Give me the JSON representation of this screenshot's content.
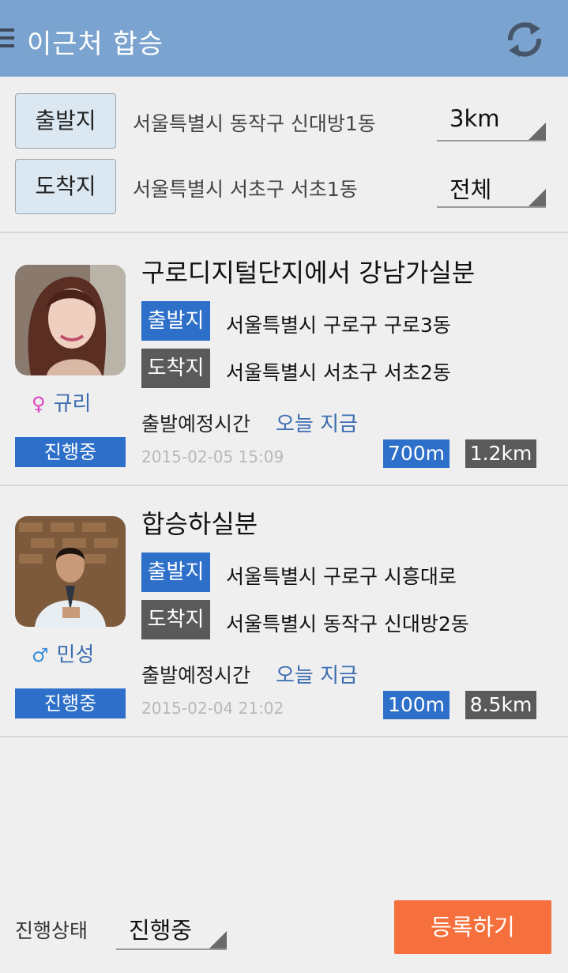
{
  "appbar": {
    "title": "이근처 합승",
    "menu_icon": "menu-icon",
    "refresh_icon": "refresh-icon"
  },
  "filter": {
    "origin": {
      "button_label": "출발지",
      "address": "서울특별시 동작구 신대방1동",
      "radius": "3km"
    },
    "destination": {
      "button_label": "도착지",
      "address": "서울특별시 서초구 서초1동",
      "radius": "전체"
    }
  },
  "cards": [
    {
      "title": "구로디지털단지에서 강남가실분",
      "user_name": "규리",
      "gender_symbol": "♀",
      "status": "진행중",
      "origin_tag": "출발지",
      "origin": "서울특별시 구로구 구로3동",
      "dest_tag": "도착지",
      "destination": "서울특별시 서초구 서초2동",
      "schedule_label": "출발예정시간",
      "schedule_value": "오늘 지금",
      "date": "2015-02-05 15:09",
      "distance_origin": "700m",
      "distance_dest": "1.2km"
    },
    {
      "title": "합승하실분",
      "user_name": "민성",
      "gender_symbol": "♂",
      "status": "진행중",
      "origin_tag": "출발지",
      "origin": "서울특별시 구로구 시흥대로",
      "dest_tag": "도착지",
      "destination": "서울특별시 동작구 신대방2동",
      "schedule_label": "출발예정시간",
      "schedule_value": "오늘 지금",
      "date": "2015-02-04 21:02",
      "distance_origin": "100m",
      "distance_dest": "8.5km"
    }
  ],
  "footer": {
    "status_label": "진행상태",
    "status_value": "진행중",
    "register_label": "등록하기"
  },
  "colors": {
    "appbar": "#7ba3cf",
    "accent_blue": "#2d6fc9",
    "dark_gray": "#5a5a5a",
    "register": "#f5703c",
    "female": "#e040c0",
    "male": "#3a8fd8"
  }
}
